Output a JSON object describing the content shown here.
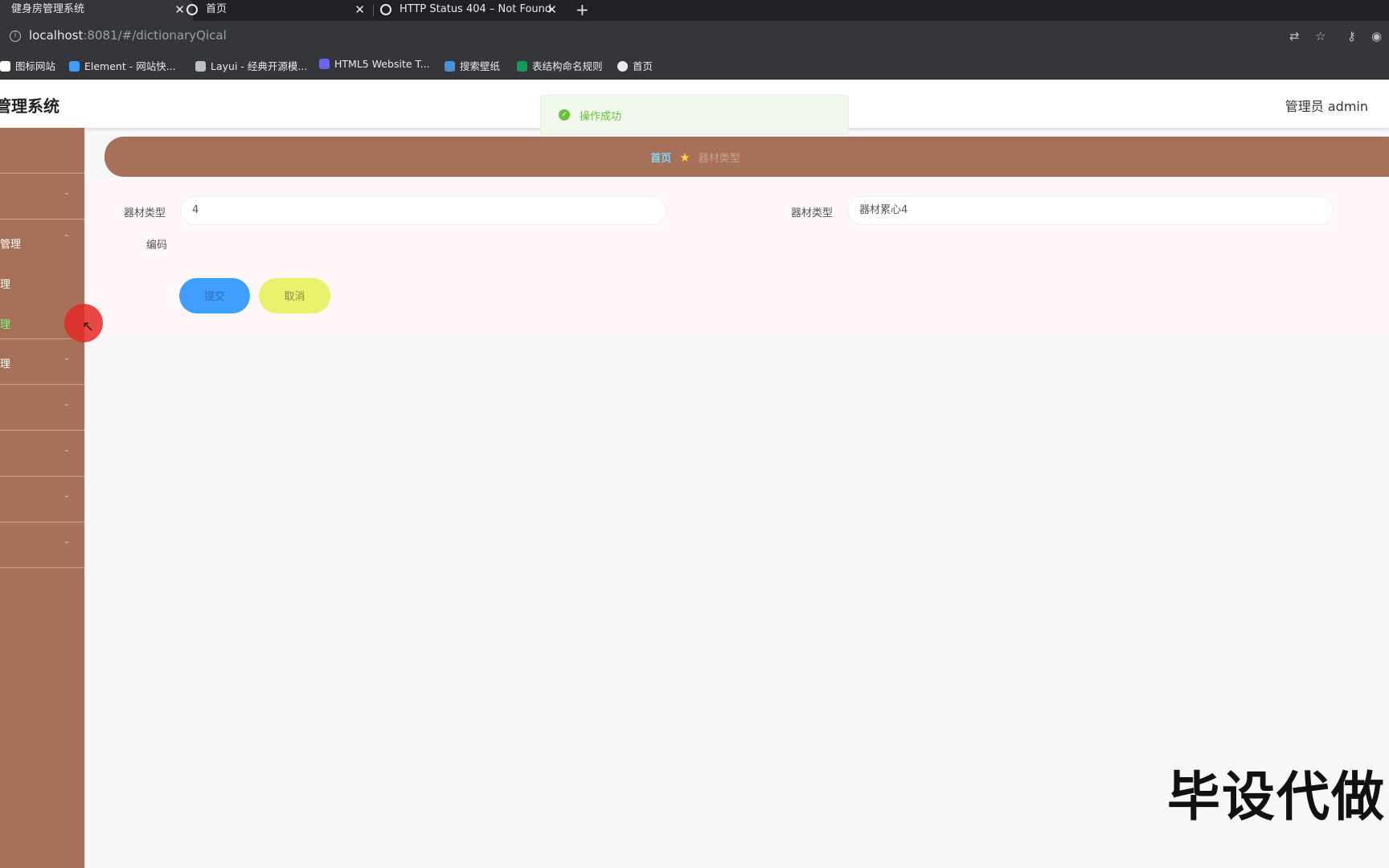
{
  "browser": {
    "tabs": [
      {
        "label": "健身房管理系统",
        "active": true
      },
      {
        "label": "首页",
        "active": false
      },
      {
        "label": "HTTP Status 404 – Not Found",
        "active": false
      }
    ],
    "new_tab": "+",
    "url_host": "localhost",
    "url_rest": ":8081/#/dictionaryQical",
    "bookmarks": [
      {
        "label": "图标网站",
        "color": "#ffffff"
      },
      {
        "label": "Element - 网站快...",
        "color": "#409eff"
      },
      {
        "label": "Layui - 经典开源模...",
        "color": "#bdc1c6"
      },
      {
        "label": "HTML5 Website T...",
        "color": "#6c63ff"
      },
      {
        "label": "搜索壁纸",
        "color": "#4a90e2"
      },
      {
        "label": "表结构命名规则",
        "color": "#0f9d58"
      },
      {
        "label": "首页",
        "color": "#e8eaed"
      }
    ]
  },
  "header": {
    "title": "管理系统",
    "user": "管理员 admin"
  },
  "toast": {
    "text": "操作成功",
    "color": "#67c23a"
  },
  "sidebar": {
    "items": [
      {
        "label": ""
      },
      {
        "label": ""
      },
      {
        "label": "管理"
      },
      {
        "label": "理"
      },
      {
        "label": "理"
      },
      {
        "label": "理"
      },
      {
        "label": ""
      },
      {
        "label": ""
      },
      {
        "label": ""
      },
      {
        "label": ""
      }
    ]
  },
  "breadcrumb": {
    "home": "首页",
    "current": "器材类型"
  },
  "form": {
    "code_label": "器材类型",
    "code_label2": "编码",
    "code_value": "4",
    "name_label": "器材类型",
    "name_value": "器材累心4",
    "submit": "提交",
    "cancel": "取消"
  },
  "watermark": "毕设代做",
  "colors": {
    "sidebar": "#a67158",
    "submit": "#409eff",
    "cancel": "#e9f26a"
  }
}
